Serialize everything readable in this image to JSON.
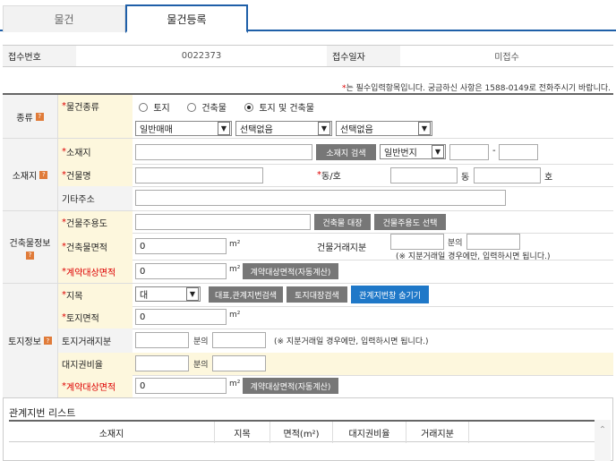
{
  "tabs": [
    {
      "label": "물건"
    },
    {
      "label": "물건등록"
    }
  ],
  "receipt": {
    "no_label": "접수번호",
    "no_value": "0022373",
    "date_label": "접수일자",
    "date_value": "미접수"
  },
  "notice": {
    "star": "*",
    "text": "는 필수입력항목입니다. 궁금하신 사항은 1588-0149로 전화주시기 바랍니다."
  },
  "kind": {
    "section": "종류",
    "label": "물건종류",
    "radios": [
      "토지",
      "건축물",
      "토지 및 건축물"
    ],
    "selected": "토지 및 건축물",
    "sel1": "일반매매",
    "sel2": "선택없음",
    "sel3": "선택없음"
  },
  "location": {
    "section": "소재지",
    "addr_label": "소재지",
    "addr_search_btn": "소재지 검색",
    "lot_type": "일반번지",
    "dash": "-",
    "bldg_label": "건물명",
    "dongho_label": "동/호",
    "dong_unit": "동",
    "ho_unit": "호",
    "other_label": "기타주소"
  },
  "building": {
    "section": "건축물정보",
    "use_label": "건물주용도",
    "ledger_btn": "건축물 대장",
    "use_select_btn": "건물주용도 선택",
    "area_label": "건축물면적",
    "area_value": "0",
    "unit": "m²",
    "share_label": "건물거래지분",
    "share_of": "분의",
    "share_note": "(※ 지분거래일 경우에만, 입력하시면 됩니다.)",
    "contract_label": "계약대상면적",
    "contract_value": "0",
    "calc_btn": "계약대상면적(자동계산)"
  },
  "land": {
    "section": "토지정보",
    "jimok_label": "지목",
    "jimok_value": "대",
    "rep_btn": "대표,관계지번검색",
    "ledger_btn": "토지대장검색",
    "hide_btn": "관계지번창 숨기기",
    "area_label": "토지면적",
    "area_value": "0",
    "unit": "m²",
    "share_label": "토지거래지분",
    "share_of": "분의",
    "share_note": "(※ 지분거래일 경우에만, 입력하시면 됩니다.)",
    "ratio_label": "대지권비율",
    "ratio_of": "분의",
    "contract_label": "계약대상면적",
    "contract_value": "0",
    "calc_btn": "계약대상면적(자동계산)"
  },
  "related_list": {
    "title": "관계지번 리스트",
    "columns": [
      "소재지",
      "지목",
      "면적(m²)",
      "대지권비율",
      "거래지분"
    ]
  }
}
